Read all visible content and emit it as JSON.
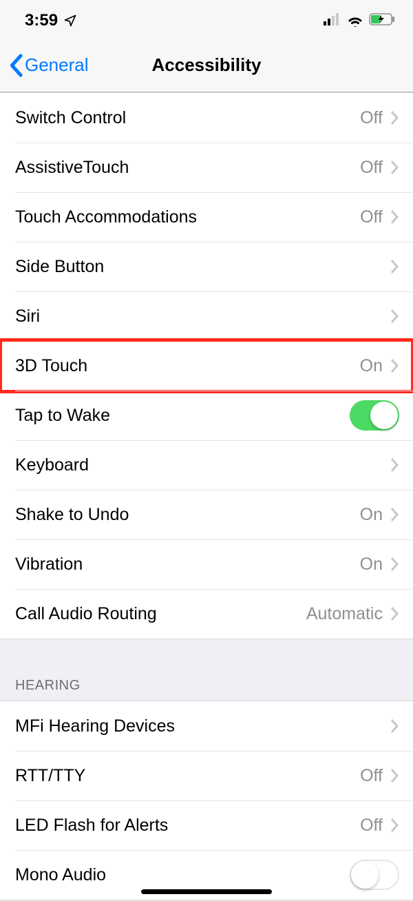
{
  "status_bar": {
    "time": "3:59"
  },
  "nav": {
    "back_label": "General",
    "title": "Accessibility"
  },
  "section1": {
    "rows": [
      {
        "label": "Switch Control",
        "value": "Off",
        "type": "disclosure"
      },
      {
        "label": "AssistiveTouch",
        "value": "Off",
        "type": "disclosure"
      },
      {
        "label": "Touch Accommodations",
        "value": "Off",
        "type": "disclosure"
      },
      {
        "label": "Side Button",
        "value": "",
        "type": "disclosure"
      },
      {
        "label": "Siri",
        "value": "",
        "type": "disclosure"
      },
      {
        "label": "3D Touch",
        "value": "On",
        "type": "disclosure",
        "highlight": true
      },
      {
        "label": "Tap to Wake",
        "value": "",
        "type": "toggle",
        "on": true
      },
      {
        "label": "Keyboard",
        "value": "",
        "type": "disclosure"
      },
      {
        "label": "Shake to Undo",
        "value": "On",
        "type": "disclosure"
      },
      {
        "label": "Vibration",
        "value": "On",
        "type": "disclosure"
      },
      {
        "label": "Call Audio Routing",
        "value": "Automatic",
        "type": "disclosure"
      }
    ]
  },
  "section2": {
    "header": "HEARING",
    "rows": [
      {
        "label": "MFi Hearing Devices",
        "value": "",
        "type": "disclosure"
      },
      {
        "label": "RTT/TTY",
        "value": "Off",
        "type": "disclosure"
      },
      {
        "label": "LED Flash for Alerts",
        "value": "Off",
        "type": "disclosure"
      },
      {
        "label": "Mono Audio",
        "value": "",
        "type": "toggle",
        "on": false
      }
    ]
  }
}
